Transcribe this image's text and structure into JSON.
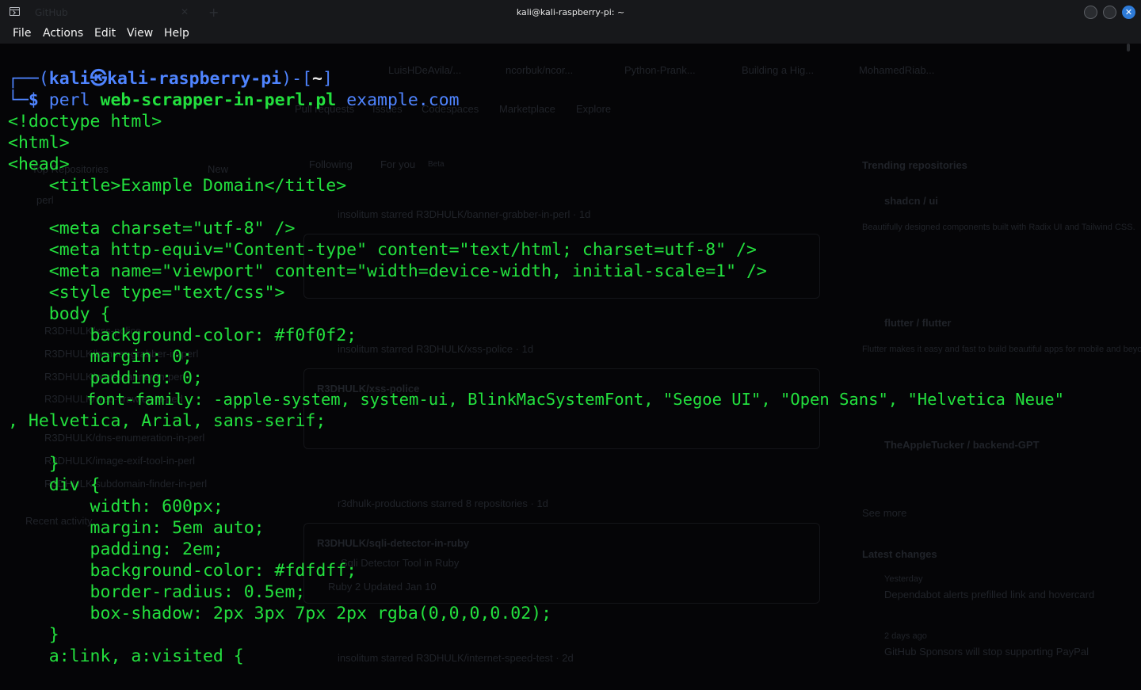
{
  "window": {
    "title": "kali@kali-raspberry-pi: ~",
    "ghost_tab_label": "GitHub"
  },
  "menu": [
    "File",
    "Actions",
    "Edit",
    "View",
    "Help"
  ],
  "colors": {
    "text_green": "#23e03e",
    "prompt_blue": "#4f84ff",
    "background": "#050507"
  },
  "prompt": {
    "open": "┌──(",
    "user": "kali",
    "at_symbol": "㉿",
    "host": "kali-raspberry-pi",
    "mid": ")-[",
    "dir": "~",
    "close": "]",
    "corner": "└─",
    "dollar": "$",
    "cmd_prog": "perl",
    "cmd_script": "web-scrapper-in-perl.pl",
    "cmd_arg": "example.com"
  },
  "output_lines": [
    "<!doctype html>",
    "<html>",
    "<head>",
    "    <title>Example Domain</title>",
    "",
    "    <meta charset=\"utf-8\" />",
    "    <meta http-equiv=\"Content-type\" content=\"text/html; charset=utf-8\" />",
    "    <meta name=\"viewport\" content=\"width=device-width, initial-scale=1\" />",
    "    <style type=\"text/css\">",
    "    body {",
    "        background-color: #f0f0f2;",
    "        margin: 0;",
    "        padding: 0;",
    "        font-family: -apple-system, system-ui, BlinkMacSystemFont, \"Segoe UI\", \"Open Sans\", \"Helvetica Neue\"",
    ", Helvetica, Arial, sans-serif;",
    "",
    "    }",
    "    div {",
    "        width: 600px;",
    "        margin: 5em auto;",
    "        padding: 2em;",
    "        background-color: #fdfdff;",
    "        border-radius: 0.5em;",
    "        box-shadow: 2px 3px 7px 2px rgba(0,0,0,0.02);",
    "    }",
    "    a:link, a:visited {"
  ],
  "background_ghost": {
    "tabs": [
      "LuisHDeAvila/...",
      "ncorbuk/ncor...",
      "Python-Prank...",
      "Building a Hig...",
      "MohamedRiab..."
    ],
    "nav": [
      "Pull requests",
      "Issues",
      "Codespaces",
      "Marketplace",
      "Explore"
    ],
    "feed_tabs": [
      "Following",
      "For you",
      "Beta"
    ],
    "sidebar_heading": "Top Repositories",
    "new_button": "New",
    "sidebar_search": "perl",
    "sidebar_repos": [
      "R3DHULK/xss-police",
      "R3DHULK/banner-grabber-in-perl",
      "R3DHULK/port-scanner-in-perl",
      "R3DHULK/web-crawler-in-perl",
      "R3DHULK/dns-enumeration-in-perl",
      "R3DHULK/image-exif-tool-in-perl",
      "R3DHULK/subdomain-finder-in-perl"
    ],
    "recent_activity": "Recent activity",
    "feed": [
      "insolitum starred R3DHULK/banner-grabber-in-perl · 1d",
      "insolitum starred R3DHULK/xss-police · 1d",
      "R3DHULK/xss-police",
      "r3dhulk-productions starred 8 repositories · 1d",
      "R3DHULK/sqli-detector-in-ruby",
      "Sqli Detector Tool in Ruby",
      "Ruby  2  Updated Jan 10",
      "insolitum starred R3DHULK/internet-speed-test · 2d"
    ],
    "trending_heading": "Trending repositories",
    "trending": [
      "shadcn / ui",
      "Beautifully designed components built with Radix UI and Tailwind CSS.",
      "flutter / flutter",
      "Flutter makes it easy and fast to build beautiful apps for mobile and beyond",
      "TheAppleTucker / backend-GPT",
      "See more"
    ],
    "latest_heading": "Latest changes",
    "latest": [
      "Yesterday",
      "Dependabot alerts prefilled link and hovercard",
      "2 days ago",
      "GitHub Sponsors will stop supporting PayPal"
    ]
  }
}
